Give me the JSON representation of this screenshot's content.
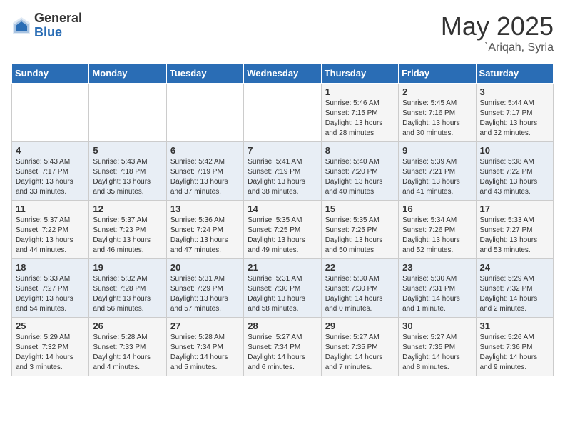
{
  "logo": {
    "general": "General",
    "blue": "Blue"
  },
  "title": "May 2025",
  "subtitle": "`Ariqah, Syria",
  "headers": [
    "Sunday",
    "Monday",
    "Tuesday",
    "Wednesday",
    "Thursday",
    "Friday",
    "Saturday"
  ],
  "weeks": [
    [
      {
        "day": "",
        "info": ""
      },
      {
        "day": "",
        "info": ""
      },
      {
        "day": "",
        "info": ""
      },
      {
        "day": "",
        "info": ""
      },
      {
        "day": "1",
        "info": "Sunrise: 5:46 AM\nSunset: 7:15 PM\nDaylight: 13 hours\nand 28 minutes."
      },
      {
        "day": "2",
        "info": "Sunrise: 5:45 AM\nSunset: 7:16 PM\nDaylight: 13 hours\nand 30 minutes."
      },
      {
        "day": "3",
        "info": "Sunrise: 5:44 AM\nSunset: 7:17 PM\nDaylight: 13 hours\nand 32 minutes."
      }
    ],
    [
      {
        "day": "4",
        "info": "Sunrise: 5:43 AM\nSunset: 7:17 PM\nDaylight: 13 hours\nand 33 minutes."
      },
      {
        "day": "5",
        "info": "Sunrise: 5:43 AM\nSunset: 7:18 PM\nDaylight: 13 hours\nand 35 minutes."
      },
      {
        "day": "6",
        "info": "Sunrise: 5:42 AM\nSunset: 7:19 PM\nDaylight: 13 hours\nand 37 minutes."
      },
      {
        "day": "7",
        "info": "Sunrise: 5:41 AM\nSunset: 7:19 PM\nDaylight: 13 hours\nand 38 minutes."
      },
      {
        "day": "8",
        "info": "Sunrise: 5:40 AM\nSunset: 7:20 PM\nDaylight: 13 hours\nand 40 minutes."
      },
      {
        "day": "9",
        "info": "Sunrise: 5:39 AM\nSunset: 7:21 PM\nDaylight: 13 hours\nand 41 minutes."
      },
      {
        "day": "10",
        "info": "Sunrise: 5:38 AM\nSunset: 7:22 PM\nDaylight: 13 hours\nand 43 minutes."
      }
    ],
    [
      {
        "day": "11",
        "info": "Sunrise: 5:37 AM\nSunset: 7:22 PM\nDaylight: 13 hours\nand 44 minutes."
      },
      {
        "day": "12",
        "info": "Sunrise: 5:37 AM\nSunset: 7:23 PM\nDaylight: 13 hours\nand 46 minutes."
      },
      {
        "day": "13",
        "info": "Sunrise: 5:36 AM\nSunset: 7:24 PM\nDaylight: 13 hours\nand 47 minutes."
      },
      {
        "day": "14",
        "info": "Sunrise: 5:35 AM\nSunset: 7:25 PM\nDaylight: 13 hours\nand 49 minutes."
      },
      {
        "day": "15",
        "info": "Sunrise: 5:35 AM\nSunset: 7:25 PM\nDaylight: 13 hours\nand 50 minutes."
      },
      {
        "day": "16",
        "info": "Sunrise: 5:34 AM\nSunset: 7:26 PM\nDaylight: 13 hours\nand 52 minutes."
      },
      {
        "day": "17",
        "info": "Sunrise: 5:33 AM\nSunset: 7:27 PM\nDaylight: 13 hours\nand 53 minutes."
      }
    ],
    [
      {
        "day": "18",
        "info": "Sunrise: 5:33 AM\nSunset: 7:27 PM\nDaylight: 13 hours\nand 54 minutes."
      },
      {
        "day": "19",
        "info": "Sunrise: 5:32 AM\nSunset: 7:28 PM\nDaylight: 13 hours\nand 56 minutes."
      },
      {
        "day": "20",
        "info": "Sunrise: 5:31 AM\nSunset: 7:29 PM\nDaylight: 13 hours\nand 57 minutes."
      },
      {
        "day": "21",
        "info": "Sunrise: 5:31 AM\nSunset: 7:30 PM\nDaylight: 13 hours\nand 58 minutes."
      },
      {
        "day": "22",
        "info": "Sunrise: 5:30 AM\nSunset: 7:30 PM\nDaylight: 14 hours\nand 0 minutes."
      },
      {
        "day": "23",
        "info": "Sunrise: 5:30 AM\nSunset: 7:31 PM\nDaylight: 14 hours\nand 1 minute."
      },
      {
        "day": "24",
        "info": "Sunrise: 5:29 AM\nSunset: 7:32 PM\nDaylight: 14 hours\nand 2 minutes."
      }
    ],
    [
      {
        "day": "25",
        "info": "Sunrise: 5:29 AM\nSunset: 7:32 PM\nDaylight: 14 hours\nand 3 minutes."
      },
      {
        "day": "26",
        "info": "Sunrise: 5:28 AM\nSunset: 7:33 PM\nDaylight: 14 hours\nand 4 minutes."
      },
      {
        "day": "27",
        "info": "Sunrise: 5:28 AM\nSunset: 7:34 PM\nDaylight: 14 hours\nand 5 minutes."
      },
      {
        "day": "28",
        "info": "Sunrise: 5:27 AM\nSunset: 7:34 PM\nDaylight: 14 hours\nand 6 minutes."
      },
      {
        "day": "29",
        "info": "Sunrise: 5:27 AM\nSunset: 7:35 PM\nDaylight: 14 hours\nand 7 minutes."
      },
      {
        "day": "30",
        "info": "Sunrise: 5:27 AM\nSunset: 7:35 PM\nDaylight: 14 hours\nand 8 minutes."
      },
      {
        "day": "31",
        "info": "Sunrise: 5:26 AM\nSunset: 7:36 PM\nDaylight: 14 hours\nand 9 minutes."
      }
    ]
  ]
}
